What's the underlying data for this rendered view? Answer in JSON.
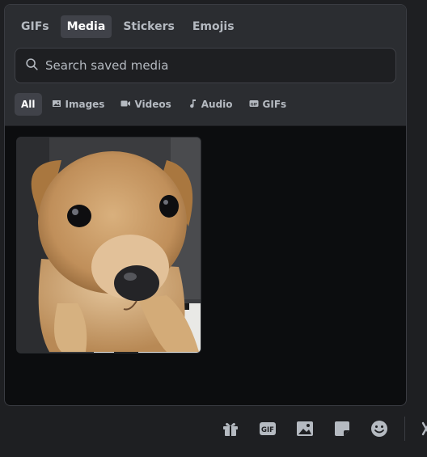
{
  "tabs": [
    {
      "label": "GIFs",
      "active": false
    },
    {
      "label": "Media",
      "active": true
    },
    {
      "label": "Stickers",
      "active": false
    },
    {
      "label": "Emojis",
      "active": false
    }
  ],
  "search": {
    "placeholder": "Search saved media",
    "value": ""
  },
  "filters": [
    {
      "label": "All",
      "icon": "none",
      "active": true
    },
    {
      "label": "Images",
      "icon": "image-icon",
      "active": false
    },
    {
      "label": "Videos",
      "icon": "video-camera-icon",
      "active": false
    },
    {
      "label": "Audio",
      "icon": "music-note-icon",
      "active": false
    },
    {
      "label": "GIFs",
      "icon": "gif-icon",
      "active": false
    }
  ],
  "media": [
    {
      "kind": "image",
      "subject": "puppy-photo"
    }
  ],
  "bottom_bar": {
    "icons": [
      "gift-icon",
      "gif-icon",
      "image-icon",
      "sticker-icon",
      "emoji-icon",
      "close-icon"
    ]
  },
  "colors": {
    "panel": "#2b2d31",
    "content_bg": "#0c0d0f",
    "active_tab": "#404249",
    "text_muted": "#b5bac1",
    "text_active": "#ffffff"
  }
}
